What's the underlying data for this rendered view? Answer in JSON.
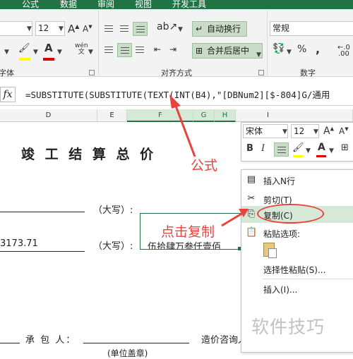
{
  "ribbon": {
    "tabs": [
      "公式",
      "数据",
      "审阅",
      "视图",
      "开发工具"
    ],
    "font_size": "12",
    "number_format": "常规",
    "wrap_text": "自动换行",
    "merge_center": "合并后居中",
    "percent": "%",
    "comma": ",",
    "phonetic": "wén",
    "group_font_partial": "字体",
    "group_alignment": "对齐方式",
    "group_number": "数字"
  },
  "formula_bar": {
    "fx": "fx",
    "formula": "=SUBSTITUTE(SUBSTITUTE(TEXT(INT(B4),\"[DBNum2][$-804]G/通用"
  },
  "columns": [
    "D",
    "E",
    "F",
    "G",
    "H",
    "I"
  ],
  "sheet": {
    "title": "竣 工 结 算 总 价",
    "daxie_1": "（大写）:",
    "amount": "3173.71",
    "daxie_2": "（大写）:",
    "chinese_amount": "伍拾肆万叁仟壹佰",
    "contractor_label": "承 包 人：",
    "cost_consultant": "造价咨询人：",
    "unit_seal": "(单位盖章)"
  },
  "mini_toolbar": {
    "font": "宋体",
    "size": "12",
    "bold": "B",
    "italic": "I",
    "font_color_letter": "A"
  },
  "context_menu": {
    "insert_row": "插入N行",
    "cut": "剪切(T)",
    "copy": "复制(C)",
    "paste_options": "粘贴选项:",
    "paste_special": "选择性粘贴(S)...",
    "insert": "插入(I)..."
  },
  "annotations": {
    "formula": "公式",
    "click_copy": "点击复制"
  },
  "watermark": "软件技巧",
  "colors": {
    "excel_green": "#217346",
    "annotation_red": "#e8433c",
    "highlight": "#d6e8d6"
  }
}
